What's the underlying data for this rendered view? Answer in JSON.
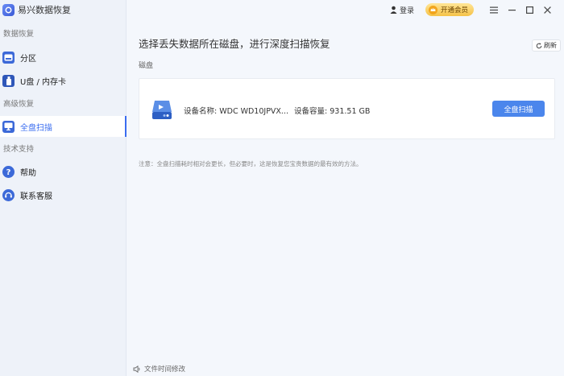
{
  "app": {
    "title": "易兴数据恢复"
  },
  "sidebar": {
    "section1": "数据恢复",
    "section2": "高级恢复",
    "section3": "技术支持",
    "items": [
      {
        "label": "分区",
        "icon": "partition-icon"
      },
      {
        "label": "U盘 / 内存卡",
        "icon": "usb-drive-icon"
      },
      {
        "label": "全盘扫描",
        "icon": "monitor-icon",
        "active": true
      },
      {
        "label": "帮助",
        "icon": "help-icon"
      },
      {
        "label": "联系客服",
        "icon": "customer-service-icon"
      }
    ]
  },
  "topbar": {
    "login": "登录",
    "vip": "开通会员"
  },
  "main": {
    "heading": "选择丢失数据所在磁盘，进行深度扫描恢复",
    "refresh": "刷新",
    "disk_section": "磁盘",
    "disk": {
      "name_label": "设备名称:",
      "name_value": "WDC WD10JPVX...",
      "capacity_label": "设备容量:",
      "capacity_value": "931.51 GB",
      "scan_button": "全盘扫描"
    },
    "note": "注意：全盘扫描耗时相对会更长，但必要时，这是恢复您宝贵数据的最有效的方法。"
  },
  "footer": {
    "status": "文件时间修改"
  },
  "colors": {
    "accent": "#4b86ec",
    "active_text": "#3a6df0",
    "vip": "#f5c248"
  }
}
